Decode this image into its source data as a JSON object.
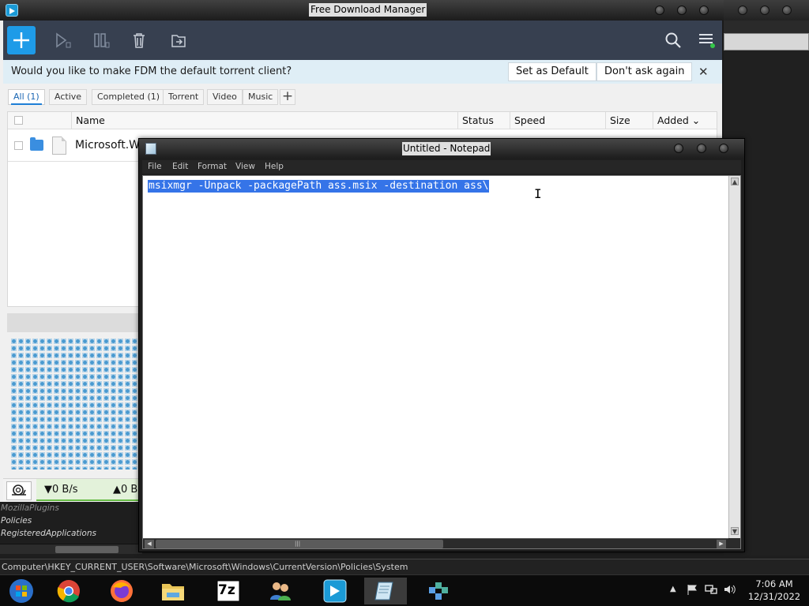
{
  "fdm": {
    "window_title": "Free Download Manager",
    "banner": {
      "text": "Would you like to make FDM the default torrent client?",
      "set_default_label": "Set as Default",
      "dont_ask_label": "Don't ask again",
      "close_glyph": "✕"
    },
    "filters": [
      "All (1)",
      "Active",
      "Completed (1)",
      "Torrent",
      "Video",
      "Music"
    ],
    "add_filter_glyph": "+",
    "columns": {
      "name": "Name",
      "status": "Status",
      "speed": "Speed",
      "size": "Size",
      "added": "Added ⌄"
    },
    "rows": [
      {
        "name": "Microsoft.Wi"
      }
    ],
    "status": {
      "down": "▼0 B/s",
      "up": "▲0 B"
    },
    "toolbar_icons": [
      "add-icon",
      "resume-icon",
      "pause-icon",
      "delete-icon",
      "move-icon",
      "search-icon",
      "menu-icon"
    ],
    "accent": "#1e9be8"
  },
  "notepad": {
    "window_title": "Untitled - Notepad",
    "menu": [
      "File",
      "Edit",
      "Format",
      "View",
      "Help"
    ],
    "content": "msixmgr -Unpack -packagePath ass.msix -destination ass\\",
    "selection_color": "#3574e8"
  },
  "regedit": {
    "tree_items": [
      "MozillaPlugins",
      "Policies",
      "RegisteredApplications"
    ],
    "status_path": "Computer\\HKEY_CURRENT_USER\\Software\\Microsoft\\Windows\\CurrentVersion\\Policies\\System"
  },
  "taskbar": {
    "apps": [
      "start-orb-icon",
      "chrome-icon",
      "firefox-icon",
      "file-explorer-icon",
      "7zip-icon",
      "network-users-icon",
      "fdm-icon",
      "notepad-icon",
      "regedit-icon"
    ],
    "seven_zip_label": "7z",
    "time": "7:06 AM",
    "date": "12/31/2022"
  }
}
